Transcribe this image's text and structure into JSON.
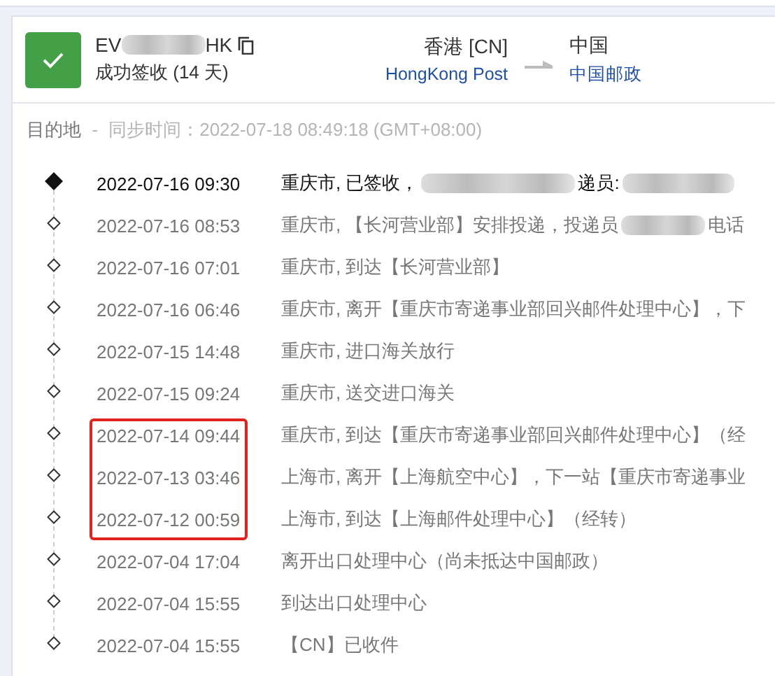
{
  "shipment": {
    "tracking_number": [
      {
        "kind": "text",
        "text": "EV"
      },
      {
        "kind": "redacted"
      },
      {
        "kind": "text",
        "text": "HK"
      }
    ],
    "status": "成功签收 (14 天)",
    "delivered": true,
    "origin": {
      "place": "香港 [CN]",
      "carrier": "HongKong Post"
    },
    "destination": {
      "place": "中国",
      "carrier": "中国邮政"
    }
  },
  "sync_line": {
    "label": "目的地",
    "separator": "-",
    "sync_text": "同步时间：2022-07-18 08:49:18 (GMT+08:00)"
  },
  "events": [
    {
      "time": "2022-07-16 09:30",
      "latest": true,
      "highlighted": false,
      "description": [
        {
          "kind": "text",
          "text": "重庆市, 已签收，"
        },
        {
          "kind": "redacted"
        },
        {
          "kind": "text",
          "text": "递员:"
        },
        {
          "kind": "redacted"
        }
      ]
    },
    {
      "time": "2022-07-16 08:53",
      "latest": false,
      "highlighted": false,
      "description": [
        {
          "kind": "text",
          "text": "重庆市, 【长河营业部】安排投递，投递员"
        },
        {
          "kind": "redacted"
        },
        {
          "kind": "text",
          "text": "电话"
        }
      ]
    },
    {
      "time": "2022-07-16 07:01",
      "latest": false,
      "highlighted": false,
      "description": [
        {
          "kind": "text",
          "text": "重庆市, 到达【长河营业部】"
        }
      ]
    },
    {
      "time": "2022-07-16 06:46",
      "latest": false,
      "highlighted": false,
      "description": [
        {
          "kind": "text",
          "text": "重庆市, 离开【重庆市寄递事业部回兴邮件处理中心】，下"
        }
      ]
    },
    {
      "time": "2022-07-15 14:48",
      "latest": false,
      "highlighted": false,
      "description": [
        {
          "kind": "text",
          "text": "重庆市, 进口海关放行"
        }
      ]
    },
    {
      "time": "2022-07-15 09:24",
      "latest": false,
      "highlighted": false,
      "description": [
        {
          "kind": "text",
          "text": "重庆市, 送交进口海关"
        }
      ]
    },
    {
      "time": "2022-07-14 09:44",
      "latest": false,
      "highlighted": true,
      "description": [
        {
          "kind": "text",
          "text": "重庆市, 到达【重庆市寄递事业部回兴邮件处理中心】（经"
        }
      ]
    },
    {
      "time": "2022-07-13 03:46",
      "latest": false,
      "highlighted": true,
      "description": [
        {
          "kind": "text",
          "text": "上海市, 离开【上海航空中心】，下一站【重庆市寄递事业"
        }
      ]
    },
    {
      "time": "2022-07-12 00:59",
      "latest": false,
      "highlighted": true,
      "description": [
        {
          "kind": "text",
          "text": "上海市, 到达【上海邮件处理中心】（经转）"
        }
      ]
    },
    {
      "time": "2022-07-04 17:04",
      "latest": false,
      "highlighted": false,
      "description": [
        {
          "kind": "text",
          "text": "离开出口处理中心（尚未抵达中国邮政）"
        }
      ]
    },
    {
      "time": "2022-07-04 15:55",
      "latest": false,
      "highlighted": false,
      "description": [
        {
          "kind": "text",
          "text": "到达出口处理中心"
        }
      ]
    },
    {
      "time": "2022-07-04 15:55",
      "latest": false,
      "highlighted": false,
      "description": [
        {
          "kind": "text",
          "text": "【CN】已收件"
        }
      ]
    }
  ]
}
